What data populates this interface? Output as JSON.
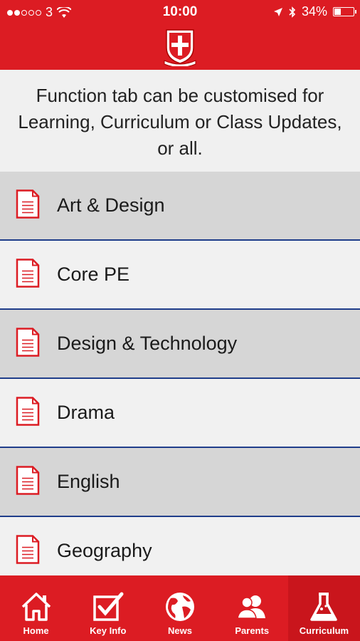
{
  "status_bar": {
    "carrier": "3",
    "time": "10:00",
    "battery": "34%",
    "battery_level": 0.34
  },
  "header": {
    "logo": "school-crest-icon"
  },
  "info_text": "Function tab can be customised for Learning, Curriculum or Class Updates, or all.",
  "subjects": [
    {
      "label": "Art & Design",
      "icon": "document-icon"
    },
    {
      "label": "Core PE",
      "icon": "document-icon"
    },
    {
      "label": "Design & Technology",
      "icon": "document-icon"
    },
    {
      "label": "Drama",
      "icon": "document-icon"
    },
    {
      "label": "English",
      "icon": "document-icon"
    },
    {
      "label": "Geography",
      "icon": "document-icon"
    }
  ],
  "tabs": [
    {
      "label": "Home",
      "icon": "home-icon"
    },
    {
      "label": "Key Info",
      "icon": "checkbox-icon"
    },
    {
      "label": "News",
      "icon": "globe-icon"
    },
    {
      "label": "Parents",
      "icon": "people-icon"
    },
    {
      "label": "Curriculum",
      "icon": "flask-icon",
      "active": true
    }
  ],
  "colors": {
    "brand_red": "#dc1c23",
    "separator_blue": "#1f3d8a",
    "row_gray": "#d6d6d6",
    "row_light": "#f1f1f1"
  }
}
